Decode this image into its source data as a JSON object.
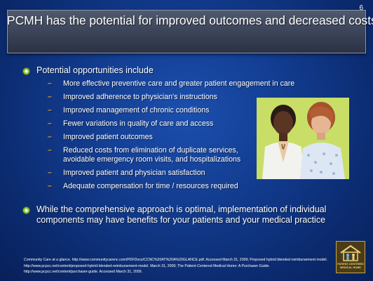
{
  "slide": {
    "number": "6",
    "title": "PCMH has the potential for improved outcomes and decreased costs"
  },
  "content": {
    "bullet1": "Potential opportunities include",
    "sub_items": [
      "More effective preventive care and greater patient engagement in care",
      "Improved adherence to physician's instructions",
      "Improved management of chronic conditions",
      "Fewer variations in quality of care and access",
      "Improved patient outcomes",
      "Reduced costs from elimination of duplicate services, avoidable emergency room visits, and hospitalizations",
      "Improved patient and physician satisfaction",
      "Adequate compensation for time / resources required"
    ],
    "bullet2": "While the comprehensive approach is optimal, implementation of individual components may have benefits for your patients and your medical practice"
  },
  "footnote": "Community Care at a glance. http://www.communitycarenc.com/PDFDocs/CCNC%20AT%20A%20GLANCE.pdf. Accessed March 31, 2009; Proposed hybrid blended reimbursement model. http://www.pcpcc.net/content/proposed-hybrid-blended-reimbursement-model. March 31, 2009; The Patient-Centered Medical Home: A Purchaser Guide. http://www.pcpcc.net/content/purchaser-guide. Accessed March 31, 2009.",
  "logo": {
    "line1": "PATIENT-CENTERED",
    "line2": "MEDICAL HOME"
  },
  "colors": {
    "background": "#133e93",
    "title_bar": "#3b4458",
    "dash": "#e8a23a",
    "bullet": "#6fa82a"
  }
}
